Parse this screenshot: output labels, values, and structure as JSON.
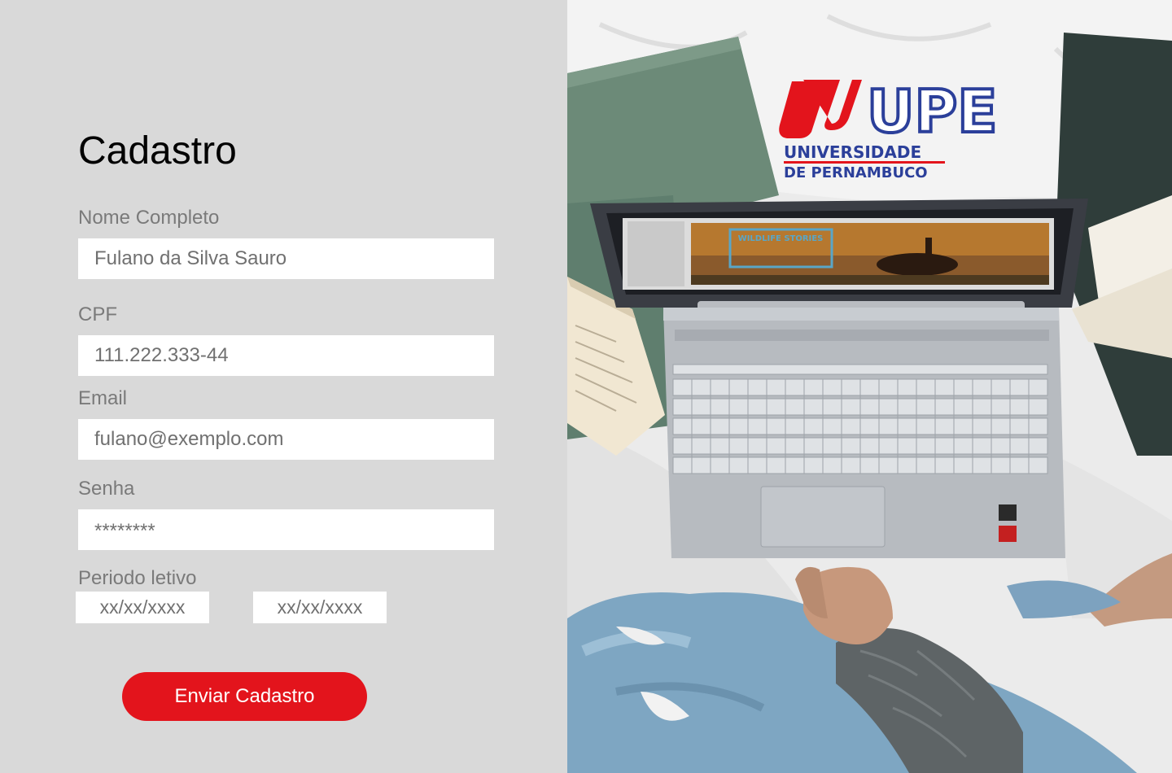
{
  "form": {
    "title": "Cadastro",
    "fields": {
      "nome": {
        "label": "Nome Completo",
        "placeholder": "Fulano da Silva Sauro"
      },
      "cpf": {
        "label": "CPF",
        "placeholder": "111.222.333-44"
      },
      "email": {
        "label": "Email",
        "placeholder": "fulano@exemplo.com"
      },
      "senha": {
        "label": "Senha",
        "placeholder": "********"
      }
    },
    "periodo": {
      "label": "Periodo letivo",
      "start_placeholder": "xx/xx/xxxx",
      "end_placeholder": "xx/xx/xxxx"
    },
    "submit_label": "Enviar Cadastro"
  },
  "hero": {
    "logo_text": "UPE",
    "logo_line1": "UNIVERSIDADE",
    "logo_line2": "DE PERNAMBUCO",
    "slide_title": "WILDLIFE STORIES"
  },
  "colors": {
    "accent": "#e3141c",
    "logo_blue": "#2b3f9a",
    "panel_bg": "#d9d9d9"
  }
}
